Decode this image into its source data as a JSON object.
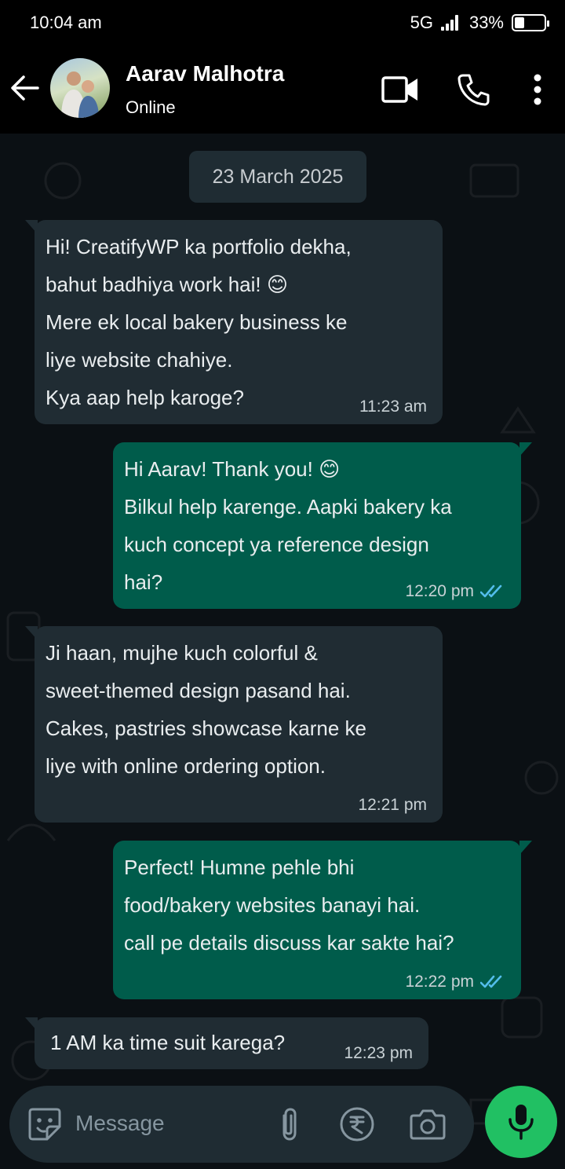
{
  "status_bar": {
    "time": "10:04 am",
    "network": "5G",
    "battery": "33%",
    "battery_level": 0.33
  },
  "header": {
    "contact_name": "Aarav Malhotra",
    "contact_status": "Online",
    "icons": [
      "back-arrow-icon",
      "video-call-icon",
      "voice-call-icon",
      "more-options-icon"
    ]
  },
  "chat": {
    "date": "23 March 2025",
    "messages": [
      {
        "direction": "in",
        "text": " Hi! CreatifyWP ka portfolio dekha,\nbahut badhiya work hai! 😊\nMere ek local bakery business ke\nliye website chahiye.\nKya aap help karoge?",
        "time": "11:23 am"
      },
      {
        "direction": "out",
        "text": " Hi Aarav! Thank you! 😊\nBilkul help karenge. Aapki bakery ka\nkuch concept ya reference design\nhai?",
        "time": "12:20 pm",
        "read": true
      },
      {
        "direction": "in",
        "text": " Ji haan, mujhe kuch colorful &\nsweet-themed design pasand hai.\nCakes, pastries showcase karne ke\nliye with online ordering option.",
        "time": "12:21 pm"
      },
      {
        "direction": "out",
        "text": " Perfect! Humne pehle bhi\nfood/bakery websites banayi hai.\ncall pe details discuss kar sakte hai?",
        "time": "12:22 pm",
        "read": true
      },
      {
        "direction": "in",
        "text": "1 AM ka time suit karega?",
        "time": "12:23 pm"
      }
    ]
  },
  "composer": {
    "placeholder": "Message",
    "icons": [
      "sticker-icon",
      "attachment-icon",
      "rupee-payment-icon",
      "camera-icon",
      "microphone-icon"
    ]
  },
  "colors": {
    "incoming_bubble": "#202c33",
    "outgoing_bubble": "#005c4b",
    "accent_green": "#21c063",
    "read_ticks": "#53bdeb"
  }
}
